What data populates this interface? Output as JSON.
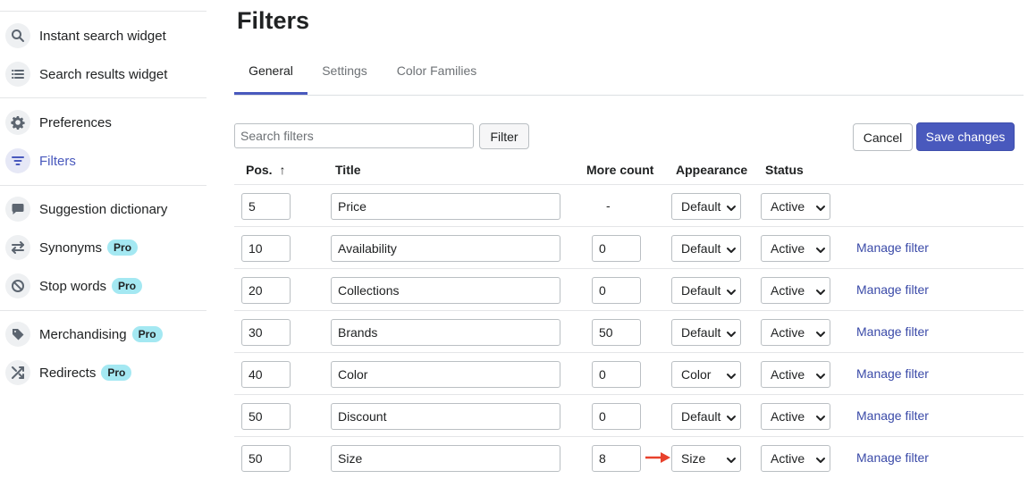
{
  "sidebar": {
    "items": [
      {
        "label": "Instant search widget",
        "icon": "search-icon"
      },
      {
        "label": "Search results widget",
        "icon": "list-icon"
      },
      {
        "label": "Preferences",
        "icon": "gear-icon"
      },
      {
        "label": "Filters",
        "icon": "filter-icon",
        "active": true
      },
      {
        "label": "Suggestion dictionary",
        "icon": "chat-icon"
      },
      {
        "label": "Synonyms",
        "icon": "swap-icon",
        "badge": "Pro"
      },
      {
        "label": "Stop words",
        "icon": "block-icon",
        "badge": "Pro"
      },
      {
        "label": "Merchandising",
        "icon": "tag-icon",
        "badge": "Pro"
      },
      {
        "label": "Redirects",
        "icon": "shuffle-icon",
        "badge": "Pro"
      }
    ]
  },
  "page": {
    "title": "Filters"
  },
  "tabs": [
    {
      "label": "General",
      "active": true
    },
    {
      "label": "Settings"
    },
    {
      "label": "Color Families"
    }
  ],
  "toolbar": {
    "search_placeholder": "Search filters",
    "search_value": "",
    "filter_label": "Filter",
    "cancel_label": "Cancel",
    "save_label": "Save changes"
  },
  "table": {
    "headers": {
      "pos": "Pos.",
      "pos_sort": "↑",
      "title": "Title",
      "more_count": "More count",
      "appearance": "Appearance",
      "status": "Status"
    },
    "rows": [
      {
        "pos": "5",
        "title": "Price",
        "more_count": "-",
        "appearance": "Default",
        "status": "Active",
        "action": ""
      },
      {
        "pos": "10",
        "title": "Availability",
        "more_count": "0",
        "appearance": "Default",
        "status": "Active",
        "action": "Manage filter"
      },
      {
        "pos": "20",
        "title": "Collections",
        "more_count": "0",
        "appearance": "Default",
        "status": "Active",
        "action": "Manage filter"
      },
      {
        "pos": "30",
        "title": "Brands",
        "more_count": "50",
        "appearance": "Default",
        "status": "Active",
        "action": "Manage filter"
      },
      {
        "pos": "40",
        "title": "Color",
        "more_count": "0",
        "appearance": "Color",
        "status": "Active",
        "action": "Manage filter"
      },
      {
        "pos": "50",
        "title": "Discount",
        "more_count": "0",
        "appearance": "Default",
        "status": "Active",
        "action": "Manage filter"
      },
      {
        "pos": "50",
        "title": "Size",
        "more_count": "8",
        "appearance": "Size",
        "status": "Active",
        "action": "Manage filter"
      }
    ]
  },
  "colors": {
    "accent": "#4959bd",
    "annotation_arrow": "#e8412c",
    "pro_badge": "#a4e8f2"
  }
}
